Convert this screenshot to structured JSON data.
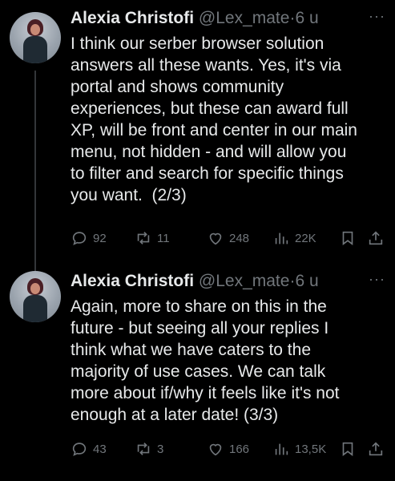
{
  "tweets": [
    {
      "name": "Alexia Christofi",
      "handle": "@Lex_mate",
      "dot": "·",
      "time": "6 u",
      "more": "···",
      "text": "I think our serber browser solution\nanswers all these wants. Yes, it's via\nportal and shows community\nexperiences, but these can award full\nXP, will be front and center in our main\nmenu, not hidden - and will allow you\nto filter and search for specific things\nyou want.  (2/3)",
      "replies": "92",
      "reposts": "11",
      "likes": "248",
      "views": "22K"
    },
    {
      "name": "Alexia Christofi",
      "handle": "@Lex_mate",
      "dot": "·",
      "time": "6 u",
      "more": "···",
      "text": "Again, more to share on this in the\nfuture - but seeing all your replies I\nthink what we have caters to the\nmajority of use cases. We can talk\nmore about if/why it feels like it's not\nenough at a later date! (3/3)",
      "replies": "43",
      "reposts": "3",
      "likes": "166",
      "views": "13,5K"
    }
  ],
  "icons": {
    "reply": "reply-icon",
    "repost": "repost-icon",
    "like": "heart-icon",
    "views": "views-chart-icon",
    "bookmark": "bookmark-icon",
    "share": "share-icon"
  },
  "colors": {
    "background": "#000000",
    "text": "#e7e9ea",
    "muted": "#71767b",
    "thread_line": "#333639"
  }
}
